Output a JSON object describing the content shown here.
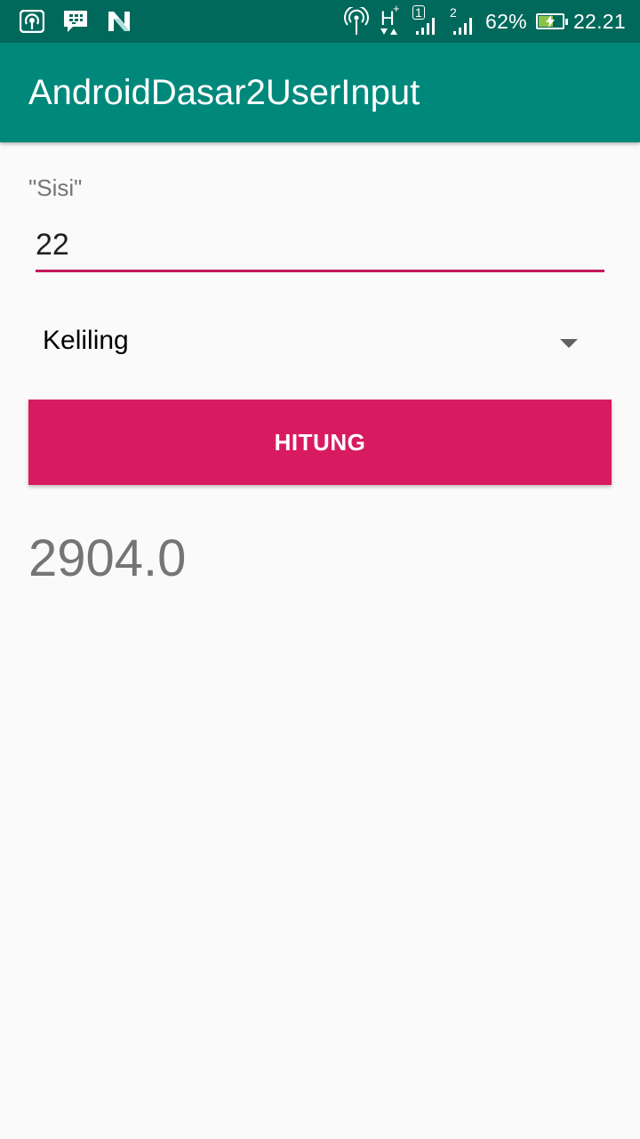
{
  "status_bar": {
    "left_icons": [
      "hotspot-icon",
      "bbm-icon",
      "n-logo-icon"
    ],
    "network_type": "H",
    "network_plus": "+",
    "sim1_label": "1",
    "sim2_label": "2",
    "battery_percent": "62%",
    "battery_level": 0.62,
    "time": "22.21",
    "colors": {
      "background": "#00695c",
      "battery_fill": "#8bc34a"
    }
  },
  "app_bar": {
    "title": "AndroidDasar2UserInput",
    "color": "#00897b"
  },
  "form": {
    "side_label": "\"Sisi\"",
    "side_value": "22",
    "operation_selected": "Keliling",
    "submit_label": "HITUNG",
    "accent_color": "#d81b60",
    "underline_color": "#c2185b"
  },
  "result": {
    "value": "2904.0"
  }
}
